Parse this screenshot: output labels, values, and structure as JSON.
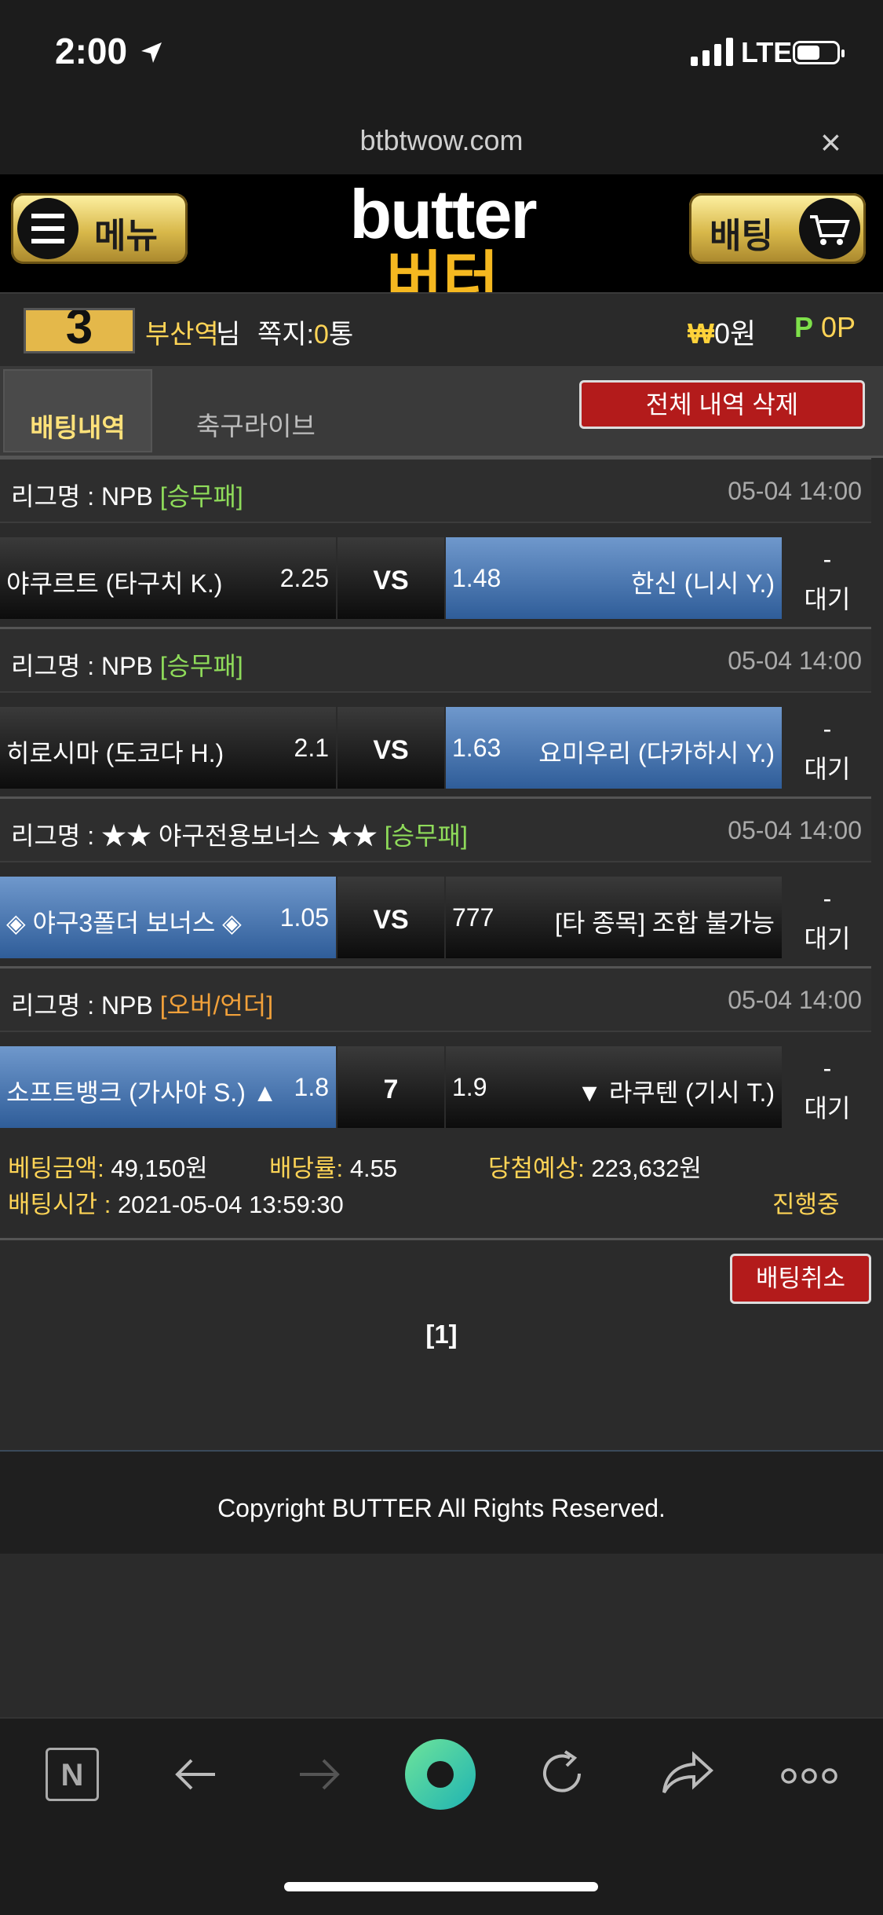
{
  "status_bar": {
    "time": "2:00",
    "network": "LTE"
  },
  "browser": {
    "url": "btbtwow.com",
    "close_glyph": "×"
  },
  "header": {
    "menu_label": "메뉴",
    "bet_label": "배팅",
    "logo_en": "butter",
    "logo_ko": "버터"
  },
  "user": {
    "avatar_glyph": "3",
    "name": "부산역",
    "name_suffix": "님",
    "memo_label": "쪽지:",
    "memo_count": "0",
    "memo_unit": "통",
    "won_symbol": "₩",
    "won_value": "0원",
    "point_symbol": "P",
    "point_value": "0P"
  },
  "tabs": {
    "active": "배팅내역",
    "other": "축구라이브",
    "delete_all": "전체 내역 삭제"
  },
  "bets": [
    {
      "league": "리그명 : NPB",
      "tag": "[승무패]",
      "datetime": "05-04 14:00",
      "home": "야쿠르트 (타구치 K.)",
      "home_odds": "2.25",
      "mid": "VS",
      "away_odds": "1.48",
      "away": "한신 (니시 Y.)",
      "status_dash": "-",
      "status": "대기"
    },
    {
      "league": "리그명 : NPB",
      "tag": "[승무패]",
      "datetime": "05-04 14:00",
      "home": "히로시마 (도코다 H.)",
      "home_odds": "2.1",
      "mid": "VS",
      "away_odds": "1.63",
      "away": "요미우리 (다카하시 Y.)",
      "status_dash": "-",
      "status": "대기"
    },
    {
      "league": "리그명 : ★★ 야구전용보너스 ★★",
      "tag": "[승무패]",
      "datetime": "05-04 14:00",
      "home": "◈ 야구3폴더 보너스 ◈",
      "home_odds": "1.05",
      "mid": "VS",
      "away_odds": "777",
      "away": "[타 종목] 조합 불가능",
      "status_dash": "-",
      "status": "대기"
    },
    {
      "league": "리그명 : NPB",
      "tag": "[오버/언더]",
      "datetime": "05-04 14:00",
      "home": "소프트뱅크 (가사야 S.) ▲",
      "home_odds": "1.8",
      "mid": "7",
      "away_odds": "1.9",
      "away": "▼ 라쿠텐 (기시 T.)",
      "status_dash": "-",
      "status": "대기"
    }
  ],
  "summary": {
    "amount_label": "베팅금액:",
    "amount": "49,150원",
    "rate_label": "배당률:",
    "rate": "4.55",
    "expected_label": "당첨예상:",
    "expected": "223,632원",
    "time_label": "배팅시간 :",
    "time": "2021-05-04 13:59:30",
    "state": "진행중"
  },
  "cancel_label": "배팅취소",
  "pager": "[1]",
  "footer": "Copyright BUTTER All Rights Reserved.",
  "toolbar": {
    "n_label": "N"
  },
  "colors": {
    "accent_gold": "#ffd456",
    "blue_pick": "#3f6fae",
    "red_button": "#b31b1b",
    "green_tag": "#8fdc5a",
    "orange_tag": "#f2a13a"
  }
}
